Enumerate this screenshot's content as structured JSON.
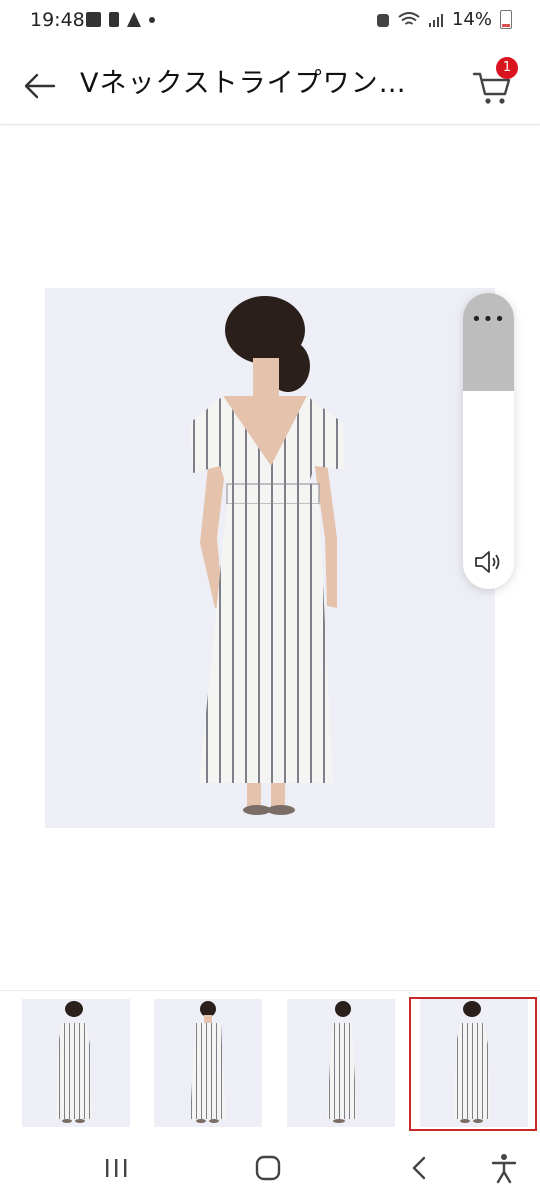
{
  "status_bar": {
    "time": "19:48",
    "battery": "14%"
  },
  "header": {
    "title": "Vネックストライプワン…",
    "cart_badge": "1"
  },
  "icons": {
    "back": "arrow-left-icon",
    "cart": "shopping-cart-icon",
    "more": "more-horizontal-icon",
    "volume": "volume-icon"
  },
  "side_panel": {
    "more_label": "•••"
  },
  "thumbnails": [
    {
      "view": "back"
    },
    {
      "view": "front"
    },
    {
      "view": "side"
    },
    {
      "view": "back",
      "selected": true
    }
  ],
  "colors": {
    "badge": "#d9141e",
    "selected_border": "#c62828",
    "photo_bg": "#eeeff6"
  }
}
